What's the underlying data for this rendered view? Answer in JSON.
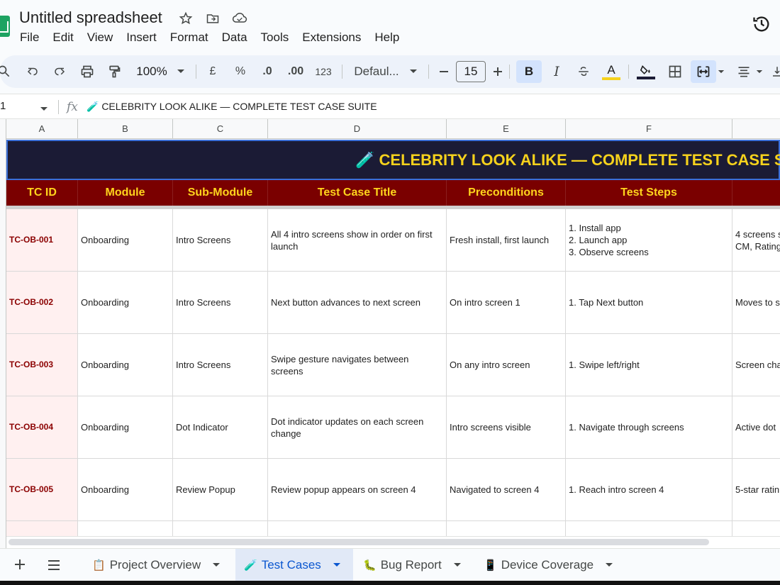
{
  "app": {
    "doc_title": "Untitled spreadsheet",
    "menu": [
      "File",
      "Edit",
      "View",
      "Insert",
      "Format",
      "Data",
      "Tools",
      "Extensions",
      "Help"
    ]
  },
  "toolbar": {
    "zoom": "100%",
    "currency": "£",
    "percent": "%",
    "dec_decrease": ".0",
    "dec_increase": ".00",
    "format_more": "123",
    "font": "Defaul...",
    "font_size": "15",
    "bold": "B",
    "italic": "I",
    "text_color_letter": "A"
  },
  "formula_bar": {
    "name_box": "1",
    "fx": "fx",
    "content": "🧪 CELEBRITY LOOK ALIKE — COMPLETE TEST CASE SUITE"
  },
  "columns": [
    "A",
    "B",
    "C",
    "D",
    "E",
    "F",
    ""
  ],
  "banner": "🧪 CELEBRITY LOOK ALIKE — COMPLETE TEST CASE SUITE",
  "headers": [
    "TC ID",
    "Module",
    "Sub-Module",
    "Test Case Title",
    "Preconditions",
    "Test Steps",
    ""
  ],
  "rows": [
    {
      "id": "TC-OB-001",
      "module": "Onboarding",
      "sub": "Intro Screens",
      "title": "All 4 intro screens show in order on first launch",
      "pre": "Fresh install, first launch",
      "steps": "1. Install app\n2. Launch app\n3. Observe screens",
      "expected": "4 screens s\nCM, Rating"
    },
    {
      "id": "TC-OB-002",
      "module": "Onboarding",
      "sub": "Intro Screens",
      "title": "Next button advances to next screen",
      "pre": "On intro screen 1",
      "steps": "1. Tap Next button",
      "expected": "Moves to s"
    },
    {
      "id": "TC-OB-003",
      "module": "Onboarding",
      "sub": "Intro Screens",
      "title": "Swipe gesture navigates between screens",
      "pre": "On any intro screen",
      "steps": "1. Swipe left/right",
      "expected": "Screen cha"
    },
    {
      "id": "TC-OB-004",
      "module": "Onboarding",
      "sub": "Dot Indicator",
      "title": "Dot indicator updates on each screen change",
      "pre": "Intro screens visible",
      "steps": "1. Navigate through screens",
      "expected": "Active dot"
    },
    {
      "id": "TC-OB-005",
      "module": "Onboarding",
      "sub": "Review Popup",
      "title": "Review popup appears on screen 4",
      "pre": "Navigated to screen 4",
      "steps": "1. Reach intro screen 4",
      "expected": "5-star ratin"
    }
  ],
  "sheet_tabs": [
    {
      "emoji": "📋",
      "label": "Project Overview",
      "active": false
    },
    {
      "emoji": "🧪",
      "label": "Test Cases",
      "active": true
    },
    {
      "emoji": "🐛",
      "label": "Bug Report",
      "active": false
    },
    {
      "emoji": "📱",
      "label": "Device Coverage",
      "active": false
    }
  ],
  "colors": {
    "banner_bg": "#1b1b35",
    "banner_text": "#f6d21c",
    "header_bg": "#7a0000",
    "header_text": "#ffd51c",
    "id_text": "#8b0000",
    "id_bg": "#fff0f0",
    "active_tab": "#0b57d0"
  }
}
